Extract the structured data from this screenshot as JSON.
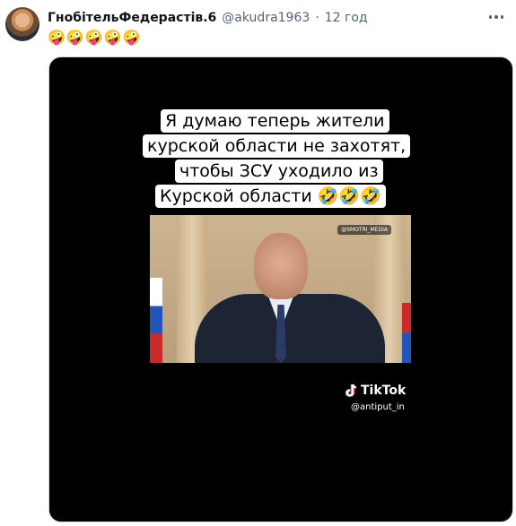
{
  "tweet": {
    "display_name": "ГнобітельФедерастів.6",
    "handle": "@akudra1963",
    "separator": "·",
    "time": "12 год",
    "text": "🤪🤪🤪🤪🤪"
  },
  "media": {
    "caption_lines": [
      "Я думаю теперь жители",
      "курской области не захотят,",
      "чтобы ЗСУ уходило из",
      "Курской области 🤣🤣🤣"
    ],
    "watermark": "@SMOTRI_MEDIA",
    "platform_name": "TikTok",
    "platform_handle": "@antiput_in"
  },
  "icons": {
    "more": "more-options-icon",
    "tiktok": "tiktok-logo-icon"
  },
  "colors": {
    "background": "#ffffff",
    "name_text": "#0f1419",
    "meta_text": "#536471",
    "media_background": "#000000"
  }
}
